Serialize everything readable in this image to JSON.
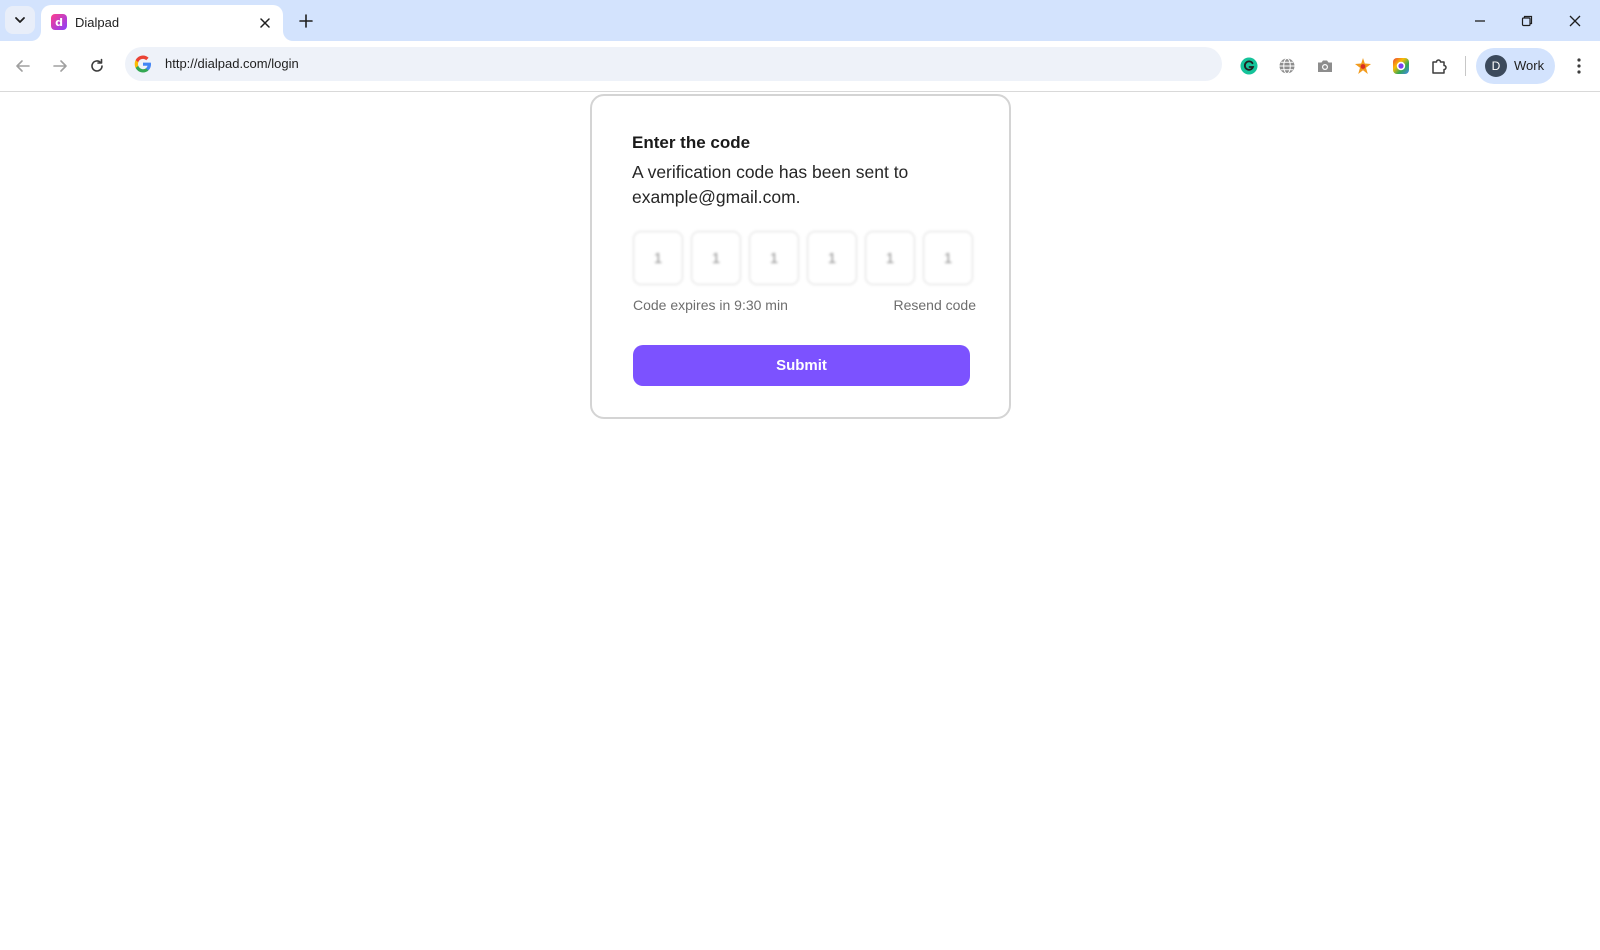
{
  "browser": {
    "tab": {
      "title": "Dialpad",
      "favicon_glyph": "d",
      "favicon_icon": "dialpad-favicon-icon"
    },
    "address_bar": {
      "url": "http://dialpad.com/login"
    },
    "profile": {
      "initial": "D",
      "label": "Work"
    },
    "extensions": [
      "grammarly-icon",
      "globe-icon",
      "camera-icon",
      "sparkle-extension-icon",
      "color-picker-icon",
      "puzzle-icon"
    ],
    "accent_color": "#d3e3fd"
  },
  "verification": {
    "title": "Enter the code",
    "description": "A verification code has been sent to example@gmail.com.",
    "code_digits": [
      "1",
      "1",
      "1",
      "1",
      "1",
      "1"
    ],
    "expiry_text": "Code expires in 9:30 min",
    "resend_label": "Resend code",
    "submit_label": "Submit",
    "submit_color": "#7c52ff"
  }
}
